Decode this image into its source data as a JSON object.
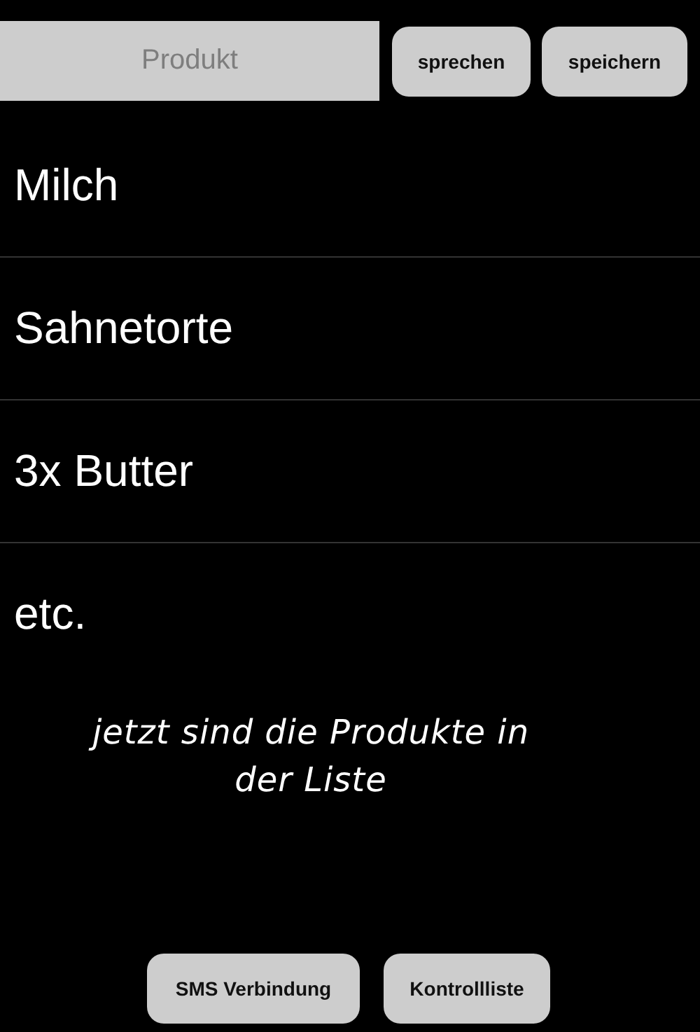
{
  "input": {
    "placeholder": "Produkt"
  },
  "top_buttons": [
    "sprechen",
    "speichern"
  ],
  "items": [
    "Milch",
    "Sahnetorte",
    "3x Butter",
    "etc."
  ],
  "note": {
    "lines": [
      "jetzt sind die Produkte in",
      "der Liste"
    ]
  },
  "bottom_buttons": [
    "SMS Verbindung",
    "Kontrollliste"
  ]
}
